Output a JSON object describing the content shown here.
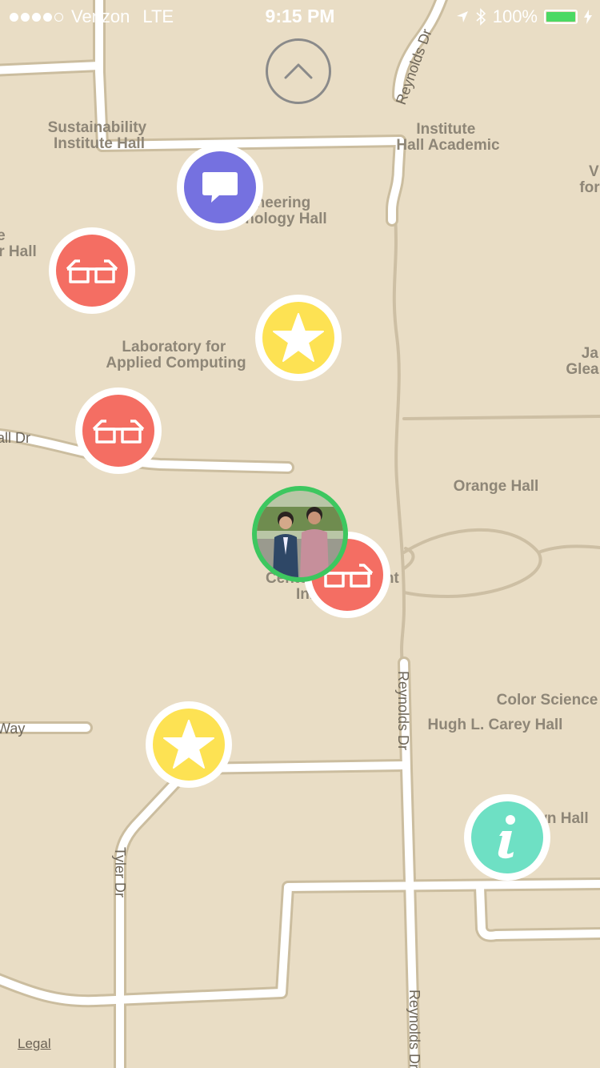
{
  "status_bar": {
    "carrier": "Verizon",
    "network": "LTE",
    "time": "9:15 PM",
    "battery": "100%",
    "signal_dots_filled": 4,
    "signal_dots_total": 5
  },
  "map": {
    "street_labels": [
      "Reynolds Dr",
      "Reynolds Dr",
      "Reynolds Dr",
      "Tyler Dr",
      "all Dr",
      "Way"
    ],
    "building_labels": [
      [
        "Sustainability",
        "Institute Hall"
      ],
      [
        "Institute",
        "Hall Academic"
      ],
      [
        "Engineering",
        "Technology Hall"
      ],
      [
        "e",
        "r Hall"
      ],
      [
        "Laboratory for",
        "Applied Computing"
      ],
      [
        "Orange Hall"
      ],
      [
        "Center for Student",
        "Innovation"
      ],
      [
        "Color Science"
      ],
      [
        "Hugh L. Carey Hall"
      ],
      [
        "Brown Hall"
      ],
      [
        "Ja",
        "Glea"
      ],
      [
        "V",
        "for"
      ]
    ],
    "legal_link": "Legal"
  },
  "markers": [
    {
      "kind": "comment",
      "icon": "speech-bubble-icon",
      "color": "#7571e0"
    },
    {
      "kind": "glasses",
      "icon": "glasses-icon",
      "color": "#f46e63"
    },
    {
      "kind": "star",
      "icon": "star-icon",
      "color": "#fde253"
    },
    {
      "kind": "glasses",
      "icon": "glasses-icon",
      "color": "#f46e63"
    },
    {
      "kind": "glasses",
      "icon": "glasses-icon",
      "color": "#f46e63"
    },
    {
      "kind": "star",
      "icon": "star-icon",
      "color": "#fde253"
    },
    {
      "kind": "info",
      "icon": "info-icon",
      "color": "#6ee0c4"
    }
  ],
  "user_marker": {
    "icon": "user-avatar",
    "ring_color": "#3dc75f"
  }
}
